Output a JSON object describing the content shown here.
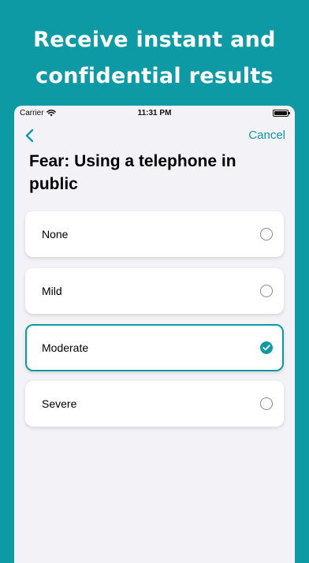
{
  "promo": {
    "line1": "Receive instant and",
    "line2": "confidential results"
  },
  "status_bar": {
    "carrier": "Carrier",
    "time": "11:31 PM",
    "icons": [
      "wifi-icon",
      "battery-icon"
    ]
  },
  "nav": {
    "back_icon": "chevron-left-icon",
    "cancel_label": "Cancel"
  },
  "question": {
    "title": "Fear: Using a telephone in public"
  },
  "options": [
    {
      "label": "None",
      "selected": false
    },
    {
      "label": "Mild",
      "selected": false
    },
    {
      "label": "Moderate",
      "selected": true
    },
    {
      "label": "Severe",
      "selected": false
    }
  ],
  "colors": {
    "accent": "#0E9AA4",
    "screen_background": "#F2F2F7",
    "card": "#FFFFFF"
  }
}
